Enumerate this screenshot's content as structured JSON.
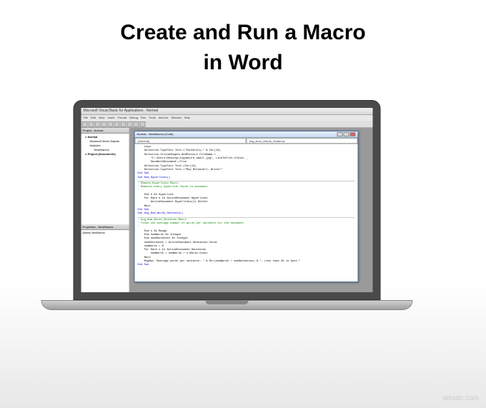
{
  "heading": {
    "line1": "Create and Run a Macro",
    "line2": "in Word"
  },
  "vba": {
    "title": "Microsoft Visual Basic for Applications - Normal",
    "menu": [
      "File",
      "Edit",
      "View",
      "Insert",
      "Format",
      "Debug",
      "Run",
      "Tools",
      "Add-Ins",
      "Window",
      "Help"
    ],
    "project_panel_title": "Project - Normal",
    "tree": {
      "root1": "Normal",
      "root1_sub1": "Microsoft Word Objects",
      "root1_sub2": "Modules",
      "root1_sub2_item": "NewMacros",
      "root2": "Project (Document1)"
    },
    "props_panel_title": "Properties - NewMacros",
    "props_name_label": "(Name)",
    "props_name_value": "NewMacros",
    "code_window_title": "Normal - NewMacros (Code)",
    "dropdown_left": "(General)",
    "dropdown_right": "Avg_Num_Words_Sentence",
    "code": [
      {
        "t": "    Loop",
        "c": ""
      },
      {
        "t": "    Selection.TypeText Text:=\"Sincerely,\" & Chr(13)",
        "c": ""
      },
      {
        "t": "    Selection.InlineShapes.AddPicture FileName:= _",
        "c": ""
      },
      {
        "t": "        \"C:\\Users\\Desktop\\signature_small.jpg\", LinkToFile:=False, _",
        "c": ""
      },
      {
        "t": "        SaveWithDocument:=True",
        "c": ""
      },
      {
        "t": "    Selection.TypeText Text:=Chr(13)",
        "c": ""
      },
      {
        "t": "    Selection.TypeText Text:=\"Roy McConnell, Writer\"",
        "c": ""
      },
      {
        "t": "End Sub",
        "c": "kw"
      },
      {
        "t": "Sub Num_Hyperlinks()",
        "c": "kw"
      },
      {
        "t": "",
        "c": "sep"
      },
      {
        "t": "' Remove_Hyperlinks Macro",
        "c": "comment"
      },
      {
        "t": "' Removes every hyperlink found in document.",
        "c": "comment"
      },
      {
        "t": "'",
        "c": "comment"
      },
      {
        "t": "    Dim h As Hyperlink",
        "c": ""
      },
      {
        "t": "    For Each h In ActiveDocument.Hyperlinks",
        "c": ""
      },
      {
        "t": "        ActiveDocument.Hyperlinks(1).Delete",
        "c": ""
      },
      {
        "t": "    Next",
        "c": ""
      },
      {
        "t": "End Sub",
        "c": "kw"
      },
      {
        "t": "Sub Avg_Num_Words_Sentence()",
        "c": "kw"
      },
      {
        "t": "",
        "c": "sep"
      },
      {
        "t": "' Avg_Num_Words_Sentence Macro",
        "c": "comment"
      },
      {
        "t": "' Finds the average number of words per sentence for the document.",
        "c": "comment"
      },
      {
        "t": "'",
        "c": "comment"
      },
      {
        "t": "    Dim s As Range",
        "c": ""
      },
      {
        "t": "    Dim numWords As Integer",
        "c": ""
      },
      {
        "t": "    Dim numSentences As Integer",
        "c": ""
      },
      {
        "t": "    numSentences = ActiveDocument.Sentences.Count",
        "c": ""
      },
      {
        "t": "    numWords = 0",
        "c": ""
      },
      {
        "t": "    For Each s In ActiveDocument.Sentences",
        "c": ""
      },
      {
        "t": "        numWords = numWords + s.Words.Count",
        "c": ""
      },
      {
        "t": "    Next",
        "c": ""
      },
      {
        "t": "    MsgBox \"Average words per sentence: \" & Str(numWords / numSentences) & \". Less than 20 is best.\"",
        "c": ""
      },
      {
        "t": "End Sub",
        "c": "kw"
      }
    ]
  },
  "watermark": "wsxdn.com"
}
